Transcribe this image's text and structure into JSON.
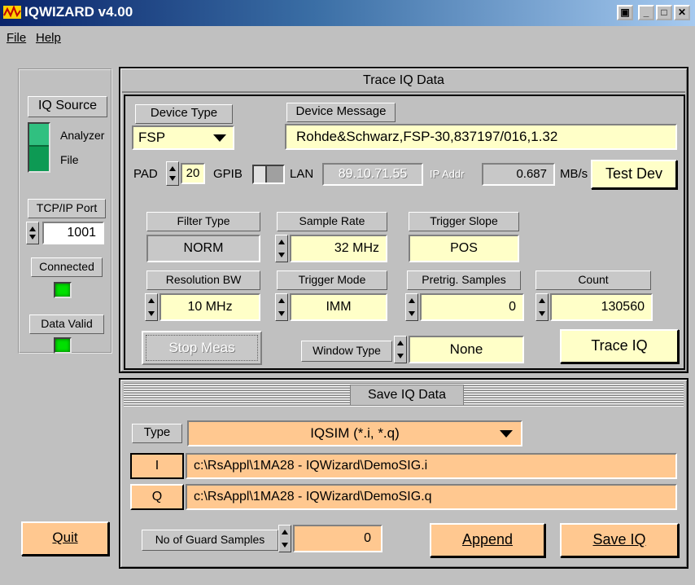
{
  "window": {
    "title": "IQWIZARD v4.00"
  },
  "menu": {
    "file": "File",
    "help": "Help"
  },
  "left": {
    "iq_source_label": "IQ Source",
    "iq_source_options": [
      "Analyzer",
      "File"
    ],
    "tcp_port_label": "TCP/IP Port",
    "tcp_port_value": "1001",
    "connected_label": "Connected",
    "data_valid_label": "Data Valid",
    "quit_label": "Quit"
  },
  "trace": {
    "title": "Trace IQ Data",
    "device_type_label": "Device Type",
    "device_type_value": "FSP",
    "device_message_label": "Device Message",
    "device_message_value": "Rohde&Schwarz,FSP-30,837197/016,1.32",
    "pad_label": "PAD",
    "pad_value": "20",
    "gpib_label": "GPIB",
    "lan_label": "LAN",
    "ip_value": "89.10.71.55",
    "ip_label": "IP Addr",
    "rate_value": "0.687",
    "rate_unit": "MB/s",
    "test_dev_label": "Test Dev",
    "filter_type_label": "Filter Type",
    "filter_type_value": "NORM",
    "sample_rate_label": "Sample Rate",
    "sample_rate_value": "32 MHz",
    "trigger_slope_label": "Trigger Slope",
    "trigger_slope_value": "POS",
    "resolution_bw_label": "Resolution BW",
    "resolution_bw_value": "10 MHz",
    "trigger_mode_label": "Trigger Mode",
    "trigger_mode_value": "IMM",
    "pretrig_label": "Pretrig. Samples",
    "pretrig_value": "0",
    "count_label": "Count",
    "count_value": "130560",
    "stop_meas_label": "Stop Meas",
    "window_type_label": "Window Type",
    "window_type_value": "None",
    "trace_iq_label": "Trace IQ"
  },
  "save": {
    "title": "Save IQ Data",
    "type_label": "Type",
    "type_value": "IQSIM (*.i, *.q)",
    "i_label": "I",
    "i_path": "c:\\RsAppl\\1MA28 - IQWizard\\DemoSIG.i",
    "q_label": "Q",
    "q_path": "c:\\RsAppl\\1MA28 - IQWizard\\DemoSIG.q",
    "guard_label": "No of Guard Samples",
    "guard_value": "0",
    "append_label": "Append",
    "save_iq_label": "Save IQ"
  },
  "colors": {
    "field": "#ffffc8",
    "orange": "#ffc890",
    "led": "#00e000"
  }
}
